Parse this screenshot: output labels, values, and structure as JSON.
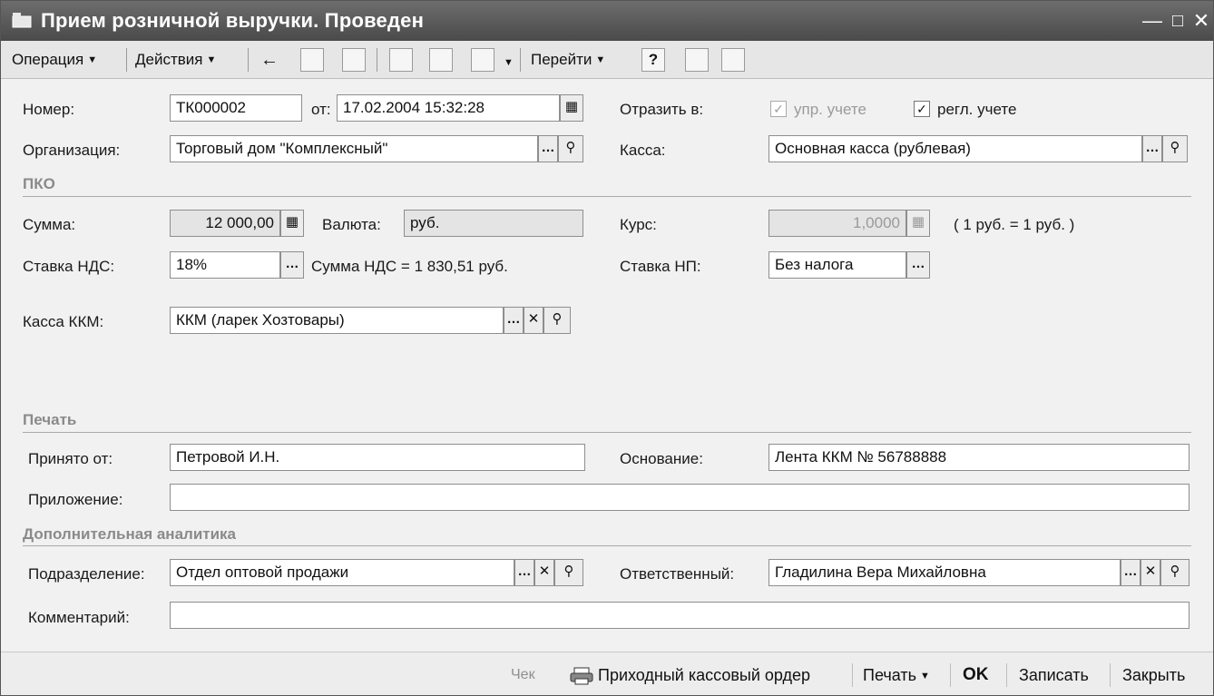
{
  "window": {
    "title": "Прием розничной выручки. Проведен"
  },
  "toolbar": {
    "operation": "Операция",
    "actions": "Действия",
    "goto": "Перейти",
    "help": "?"
  },
  "form": {
    "number_label": "Номер:",
    "number_value": "ТК000002",
    "date_label": "от:",
    "date_value": "17.02.2004 15:32:28",
    "reflect_label": "Отразить в:",
    "upr_label": "упр. учете",
    "regl_label": "регл. учете",
    "org_label": "Организация:",
    "org_value": "Торговый дом \"Комплексный\"",
    "kassa_label": "Касса:",
    "kassa_value": "Основная касса (рублевая)",
    "pko_section": "ПКО",
    "sum_label": "Сумма:",
    "sum_value": "12 000,00",
    "currency_label": "Валюта:",
    "currency_value": "руб.",
    "rate_label": "Курс:",
    "rate_value": "1,0000",
    "rate_note": "( 1 руб. = 1 руб. )",
    "vat_label": "Ставка НДС:",
    "vat_value": "18%",
    "vat_sum_text": "Сумма НДС = 1 830,51 руб.",
    "np_label": "Ставка НП:",
    "np_value": "Без налога",
    "kkm_label": "Касса ККМ:",
    "kkm_value": "ККМ (ларек Хозтовары)",
    "print_section": "Печать",
    "from_label": "Принято от:",
    "from_value": "Петровой И.Н.",
    "basis_label": "Основание:",
    "basis_value": "Лента ККМ № 56788888",
    "appendix_label": "Приложение:",
    "appendix_value": "",
    "analytics_section": "Дополнительная аналитика",
    "dept_label": "Подразделение:",
    "dept_value": "Отдел оптовой продажи",
    "resp_label": "Ответственный:",
    "resp_value": "Гладилина Вера Михайловна",
    "comment_label": "Комментарий:",
    "comment_value": ""
  },
  "footer": {
    "check": "Чек",
    "pko_order": "Приходный кассовый ордер",
    "print": "Печать",
    "ok": "OK",
    "save": "Записать",
    "close": "Закрыть"
  },
  "icons": [
    "window-icon",
    "minimize-icon",
    "maximize-icon",
    "close-icon",
    "back-icon",
    "copy-icon",
    "forward-icon",
    "post-icon",
    "unpost-icon",
    "structure-icon",
    "help-icon",
    "list-icon",
    "settings-icon",
    "calendar-icon",
    "calculator-icon",
    "ellipsis-icon",
    "search-icon",
    "clear-icon",
    "printer-icon"
  ]
}
